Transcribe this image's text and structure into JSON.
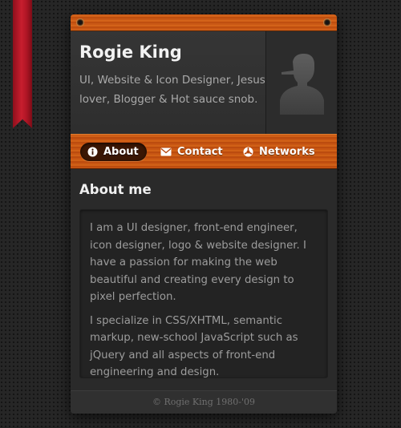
{
  "profile": {
    "name": "Rogie King",
    "bio": "UI, Website & Icon Designer, Jesus lover, Blogger & Hot sauce snob."
  },
  "nav": {
    "tabs": [
      {
        "label": "About",
        "icon": "info-icon",
        "active": true
      },
      {
        "label": "Contact",
        "icon": "envelope-icon",
        "active": false
      },
      {
        "label": "Networks",
        "icon": "globe-icon",
        "active": false
      }
    ]
  },
  "about": {
    "title": "About me",
    "paragraphs": [
      "I am a UI designer, front-end engineer, icon designer, logo & website designer. I have a passion for making the web beautiful and creating every design to pixel perfection.",
      "I specialize in CSS/XHTML, semantic markup, new-school JavaScript such as jQuery and all aspects of front-end engineering and design."
    ]
  },
  "footer": {
    "copyright": "© Rogie King 1980-'09"
  },
  "colors": {
    "ribbon": "#c01a2a",
    "wood": "#d0601a",
    "background": "#262626"
  }
}
